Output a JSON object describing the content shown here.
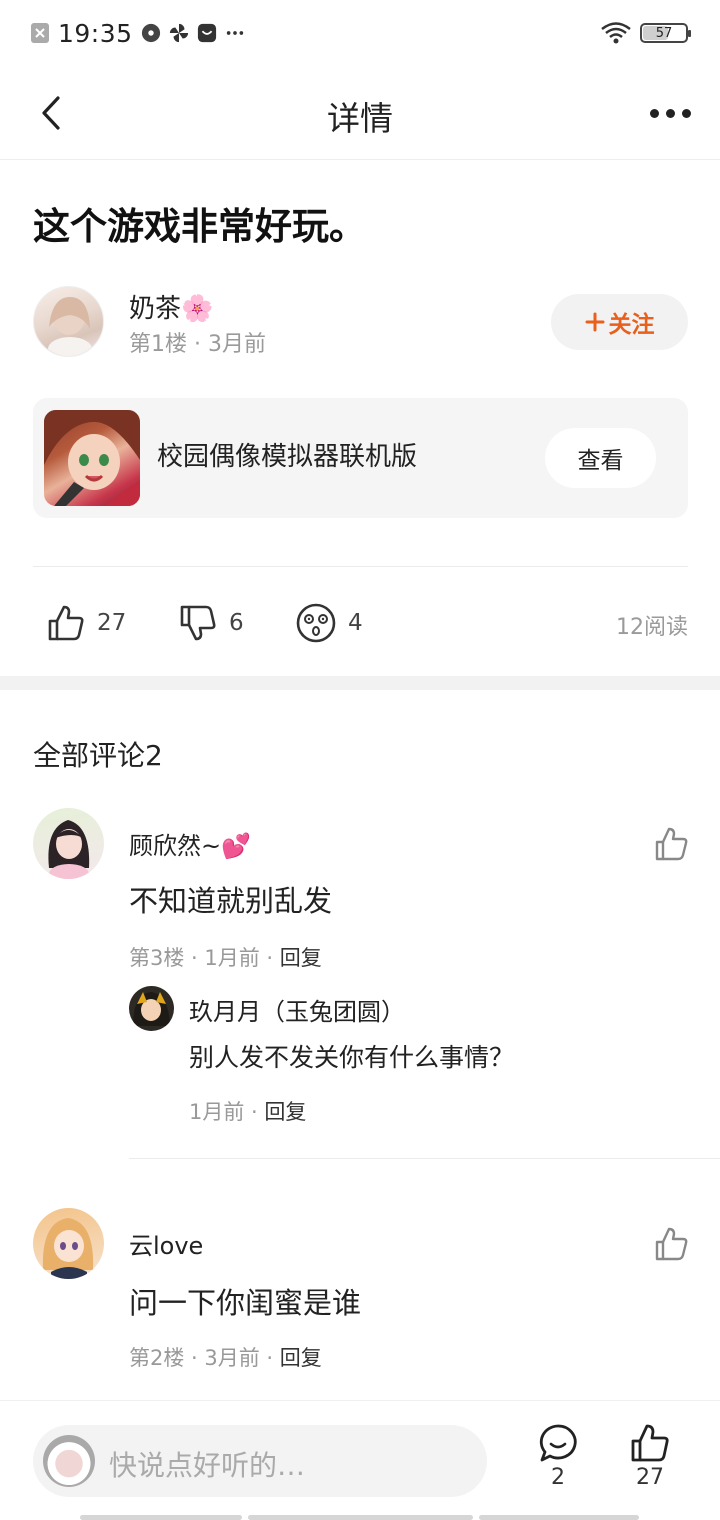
{
  "status_bar": {
    "time": "19:35",
    "battery": "57",
    "battery_level": 0.57
  },
  "nav": {
    "title": "详情"
  },
  "post": {
    "title": "这个游戏非常好玩。",
    "author": {
      "name": "奶茶🌸",
      "meta": "第1楼 · 3月前",
      "follow_label": "关注"
    },
    "game": {
      "name": "校园偶像模拟器联机版",
      "view_label": "查看"
    },
    "reactions": {
      "likes": "27",
      "dislikes": "6",
      "funny": "4",
      "reads": "12阅读"
    }
  },
  "comments_header": "全部评论2",
  "comments": [
    {
      "name": "顾欣然~💕",
      "text": "不知道就别乱发",
      "meta_prefix": "第3楼 · 1月前 · ",
      "reply_label": "回复",
      "reply": {
        "name": "玖月月（玉兔团圆）",
        "text": "别人发不发关你有什么事情？",
        "meta_prefix": "1月前 · ",
        "reply_label": "回复"
      }
    },
    {
      "name": "云love",
      "text": "问一下你闺蜜是谁",
      "meta_prefix": "第2楼 · 3月前 · ",
      "reply_label": "回复"
    }
  ],
  "bottom_bar": {
    "input_placeholder": "快说点好听的…",
    "comment_count": "2",
    "like_count": "27"
  },
  "colors": {
    "accent": "#e8601c",
    "text": "#222222",
    "muted": "#999999",
    "card_bg": "#f5f5f5"
  }
}
